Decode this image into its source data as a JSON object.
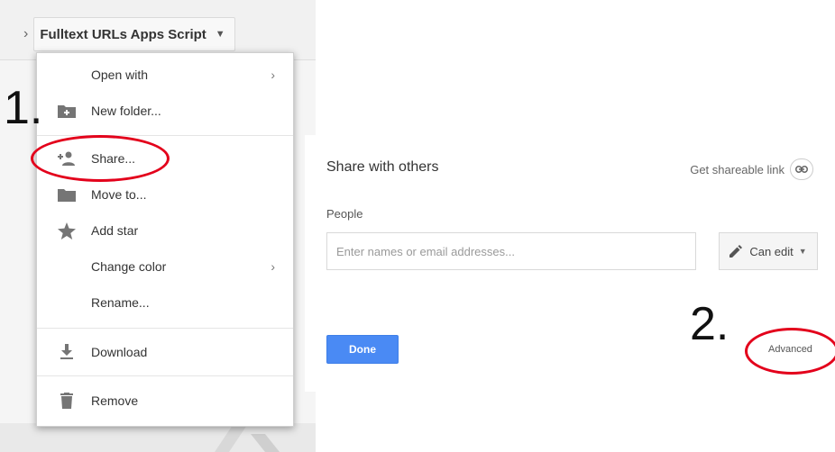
{
  "breadcrumb": {
    "folder_name": "Fulltext URLs Apps Script"
  },
  "menu": {
    "items": [
      {
        "label": "Open with",
        "has_submenu": true
      },
      {
        "label": "New folder...",
        "icon": "new-folder-icon"
      },
      {
        "label": "Share...",
        "icon": "share-person-icon"
      },
      {
        "label": "Move to...",
        "icon": "folder-icon"
      },
      {
        "label": "Add star",
        "icon": "star-icon"
      },
      {
        "label": "Change color",
        "has_submenu": true
      },
      {
        "label": "Rename..."
      },
      {
        "label": "Download",
        "icon": "download-icon"
      },
      {
        "label": "Remove",
        "icon": "trash-icon"
      }
    ]
  },
  "annotations": {
    "step1": "1.",
    "step2": "2.",
    "color": "#e3001b"
  },
  "dialog": {
    "title": "Share with others",
    "get_link_label": "Get shareable link",
    "people_label": "People",
    "people_placeholder": "Enter names or email addresses...",
    "permission_label": "Can edit",
    "done_label": "Done",
    "advanced_label": "Advanced",
    "accent_color": "#4a8af4"
  }
}
